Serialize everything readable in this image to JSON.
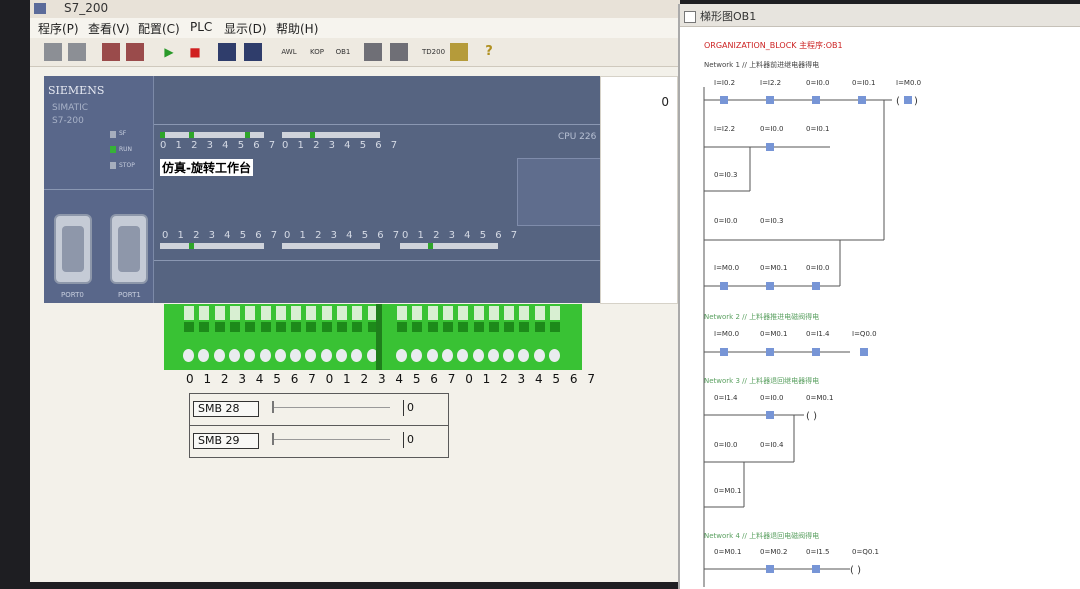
{
  "window": {
    "title": "S7_200",
    "menu": [
      "程序(P)",
      "查看(V)",
      "配置(C)",
      "PLC",
      "显示(D)",
      "帮助(H)"
    ],
    "toolbar_labels": [
      "AWL",
      "KOP",
      "OB1",
      "TD200"
    ]
  },
  "plc": {
    "brand": "SIEMENS",
    "line1": "SIMATIC",
    "line2": "S7-200",
    "status_sf": "SF",
    "status_run": "RUN",
    "status_stop": "STOP",
    "port0": "PORT0",
    "port1": "PORT1",
    "cpu": "CPU 226",
    "sim_label": "仿真-旋转工作台",
    "digits": "0 1 2 3 4 5 6 7",
    "status_value": "0"
  },
  "switches": {
    "numbers": "0 1 2 3 4 5 6 7 0 1 2 3 4   5 6 7 0 1 2 3 4 5 6 7"
  },
  "smb": [
    {
      "label": "SMB 28",
      "value": "0"
    },
    {
      "label": "SMB 29",
      "value": "0"
    }
  ],
  "ladder": {
    "window_title": "梯形图OB1",
    "header": "ORGANIZATION_BLOCK 主程序:OB1",
    "networks": [
      {
        "title": "Network 1 // 上料器前进继电器得电",
        "rows": [
          [
            "I=I0.2",
            "I=I2.2",
            "0=I0.0",
            "0=I0.1",
            "I=M0.0"
          ],
          [
            "I=I2.2",
            "0=I0.0",
            "0=I0.1"
          ],
          [
            "0=I0.3"
          ],
          [
            "0=I0.0",
            "0=I0.3"
          ],
          [
            "I=M0.0",
            "0=M0.1",
            "0=I0.0"
          ]
        ]
      },
      {
        "title": "Network 2 // 上料器推进电磁阀得电",
        "rows": [
          [
            "I=M0.0",
            "0=M0.1",
            "0=I1.4",
            "I=Q0.0"
          ]
        ]
      },
      {
        "title": "Network 3 // 上料器退回继电器得电",
        "rows": [
          [
            "0=I1.4",
            "0=I0.0",
            "0=M0.1"
          ],
          [
            "0=I0.0",
            "0=I0.4"
          ],
          [
            "0=M0.1"
          ]
        ]
      },
      {
        "title": "Network 4 // 上料器退回电磁阀得电",
        "rows": [
          [
            "0=M0.1",
            "0=M0.2",
            "0=I1.5",
            "0=Q0.1"
          ]
        ]
      }
    ]
  },
  "colors": {
    "plc_panel": "#566481",
    "switch_green": "#39c234",
    "header_red": "#cc2222",
    "led_green": "#2ea52a"
  }
}
